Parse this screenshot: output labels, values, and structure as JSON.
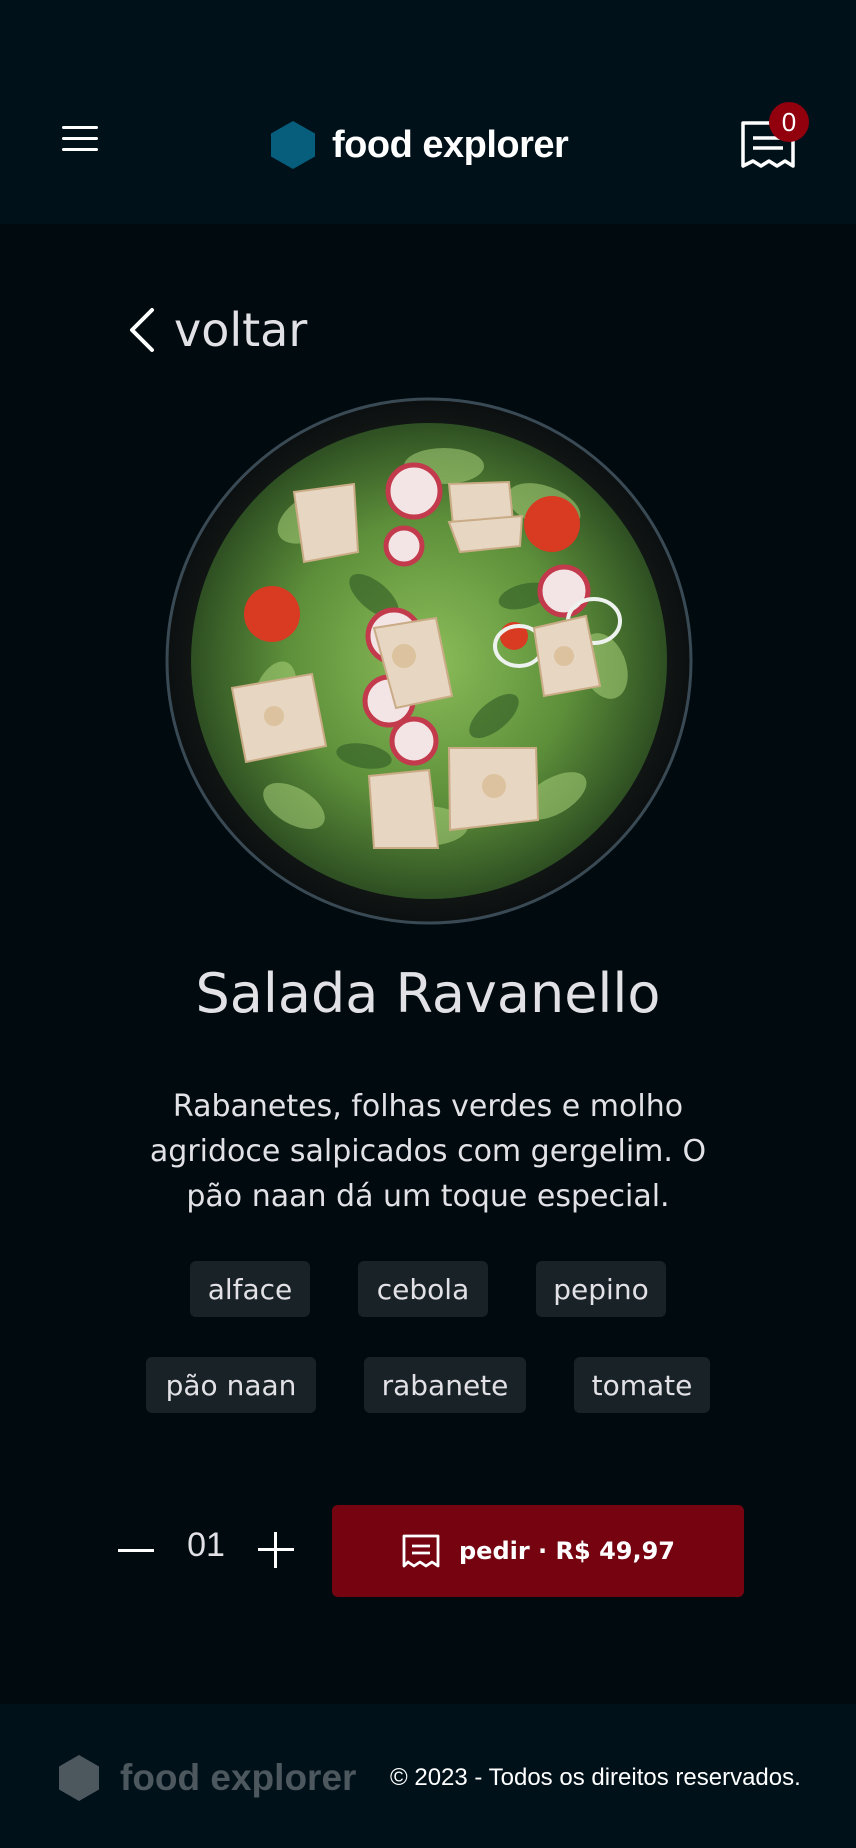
{
  "header": {
    "brand": "food explorer",
    "cart_count": "0"
  },
  "back_label": "voltar",
  "dish": {
    "title": "Salada Ravanello",
    "description": "Rabanetes, folhas verdes e molho agridoce salpicados com gergelim. O pão naan dá um toque especial.",
    "ingredients": [
      "alface",
      "cebola",
      "pepino",
      "pão naan",
      "rabanete",
      "tomate"
    ]
  },
  "order": {
    "quantity": "01",
    "button_label": "pedir ∙ R$ 49,97"
  },
  "footer": {
    "brand": "food explorer",
    "copyright": "© 2023 - Todos os direitos reservados."
  },
  "colors": {
    "background": "#000a0f",
    "header_bg": "#00111a",
    "logo_blue": "#065e7c",
    "badge_red": "#92000e",
    "button_red": "#750310",
    "tag_bg": "#192227",
    "footer_logo": "#4d585e"
  },
  "icons": {
    "menu": "menu-icon",
    "logo": "hexagon-logo-icon",
    "receipt": "receipt-icon",
    "back": "chevron-left-icon",
    "minus": "minus-icon",
    "plus": "plus-icon"
  }
}
